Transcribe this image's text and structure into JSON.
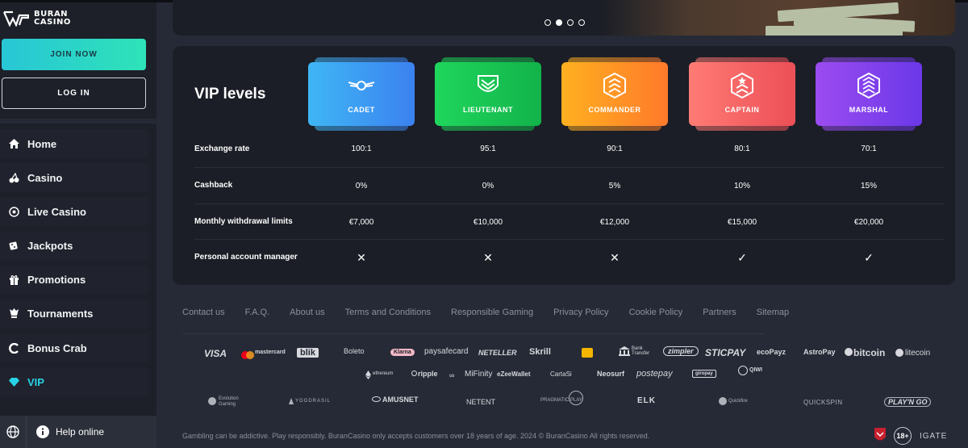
{
  "brand": {
    "line1": "BURAN",
    "line2": "CASINO"
  },
  "auth": {
    "join_label": "JOIN NOW",
    "login_label": "LOG IN"
  },
  "nav": {
    "items": [
      {
        "label": "Home",
        "icon": "home-icon"
      },
      {
        "label": "Casino",
        "icon": "cherries-icon"
      },
      {
        "label": "Live Casino",
        "icon": "roulette-icon"
      },
      {
        "label": "Jackpots",
        "icon": "dice-icon"
      },
      {
        "label": "Promotions",
        "icon": "gift-icon"
      },
      {
        "label": "Tournaments",
        "icon": "trophy-icon"
      },
      {
        "label": "Bonus Crab",
        "icon": "claw-icon"
      },
      {
        "label": "VIP",
        "icon": "diamond-icon",
        "active": true
      }
    ]
  },
  "help": {
    "label": "Help online"
  },
  "carousel": {
    "dots": 4,
    "active": 1
  },
  "vip": {
    "title": "VIP levels",
    "levels": [
      {
        "name": "CADET",
        "color_from": "#3fb6f5",
        "color_to": "#3b82f0"
      },
      {
        "name": "LIEUTENANT",
        "color_from": "#1fd65c",
        "color_to": "#12b34a"
      },
      {
        "name": "COMMANDER",
        "color_from": "#ffb020",
        "color_to": "#ff7a2a"
      },
      {
        "name": "CAPTAIN",
        "color_from": "#ff7b74",
        "color_to": "#ec4f57"
      },
      {
        "name": "MARSHAL",
        "color_from": "#9b4cf0",
        "color_to": "#6b38e8"
      }
    ],
    "rows": [
      {
        "label": "Exchange rate",
        "values": [
          "100:1",
          "95:1",
          "90:1",
          "80:1",
          "70:1"
        ]
      },
      {
        "label": "Cashback",
        "values": [
          "0%",
          "0%",
          "5%",
          "10%",
          "15%"
        ]
      },
      {
        "label": "Monthly withdrawal limits",
        "values": [
          "€7,000",
          "€10,000",
          "€12,000",
          "€15,000",
          "€20,000"
        ]
      },
      {
        "label": "Personal account manager",
        "values": [
          "✕",
          "✕",
          "✕",
          "✓",
          "✓"
        ]
      }
    ]
  },
  "footer": {
    "links": [
      "Contact us",
      "F.A.Q.",
      "About us",
      "Terms and Conditions",
      "Responsible Gaming",
      "Privacy Policy",
      "Cookie Policy",
      "Partners",
      "Sitemap"
    ],
    "payments_row1": [
      "VISA",
      "mastercard",
      "blik",
      "Boleto",
      "Klarna",
      "paysafecard",
      "NETELLER",
      "Skrill",
      "Bank Transfer",
      "zimpler",
      "STICPAY",
      "ecoPayz",
      "AstroPay",
      "bitcoin",
      "litecoin"
    ],
    "payments_row2": [
      "ethereum",
      "ripple",
      "MiFinity",
      "eZeeWallet",
      "CartaSi",
      "Neosurf",
      "postepay",
      "giropay",
      "QIWI"
    ],
    "providers": [
      "Evolution Gaming",
      "YGGDRASIL",
      "AMUSNET",
      "NETENT",
      "PRAGMATIC PLAY",
      "ELK",
      "Quickfire",
      "QUICKSPIN",
      "PLAY'N GO"
    ],
    "legal": "Gambling can be addictive. Play responsibly. BuranCasino only accepts customers over 18 years of age. 2024 © BuranCasino All rights reserved.",
    "age": "18+",
    "igate": "IGATE"
  }
}
